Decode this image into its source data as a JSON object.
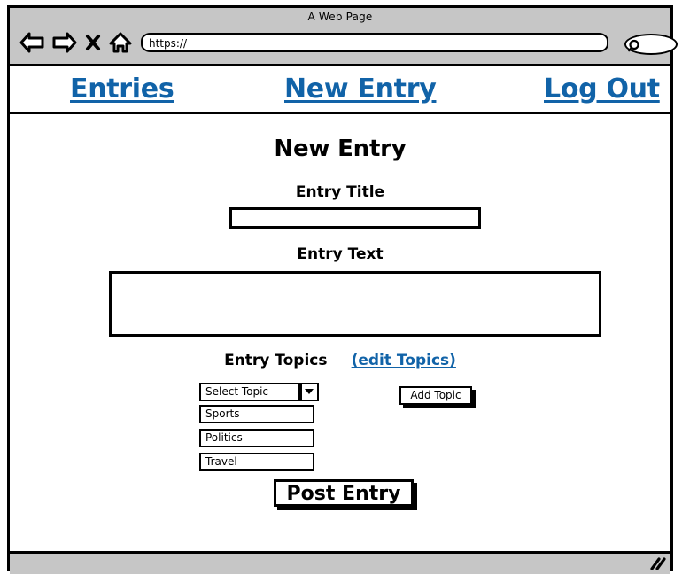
{
  "browser": {
    "window_title": "A Web Page",
    "url_value": "https://",
    "url_placeholder": "https://",
    "search_placeholder": "",
    "icons": {
      "back": "back-arrow-icon",
      "forward": "forward-arrow-icon",
      "stop": "close-x-icon",
      "home": "home-icon",
      "search": "search-icon",
      "resize": "resize-grip-icon"
    }
  },
  "site_nav": {
    "links": [
      {
        "label": "Entries"
      },
      {
        "label": "New Entry"
      },
      {
        "label": "Log Out"
      }
    ]
  },
  "main": {
    "heading": "New Entry",
    "title_field": {
      "label": "Entry Title",
      "value": "",
      "placeholder": ""
    },
    "text_field": {
      "label": "Entry Text",
      "value": "",
      "placeholder": ""
    },
    "topics": {
      "label": "Entry Topics",
      "edit_link": "(edit Topics)",
      "select_value": "Select Topic",
      "options": [
        {
          "label": "Sports"
        },
        {
          "label": "Politics"
        },
        {
          "label": "Travel"
        }
      ],
      "add_button": "Add Topic"
    },
    "submit_button": "Post Entry"
  },
  "colors": {
    "link": "#1163a8",
    "chrome": "#c6c6c6",
    "ink": "#000000",
    "page": "#ffffff"
  }
}
